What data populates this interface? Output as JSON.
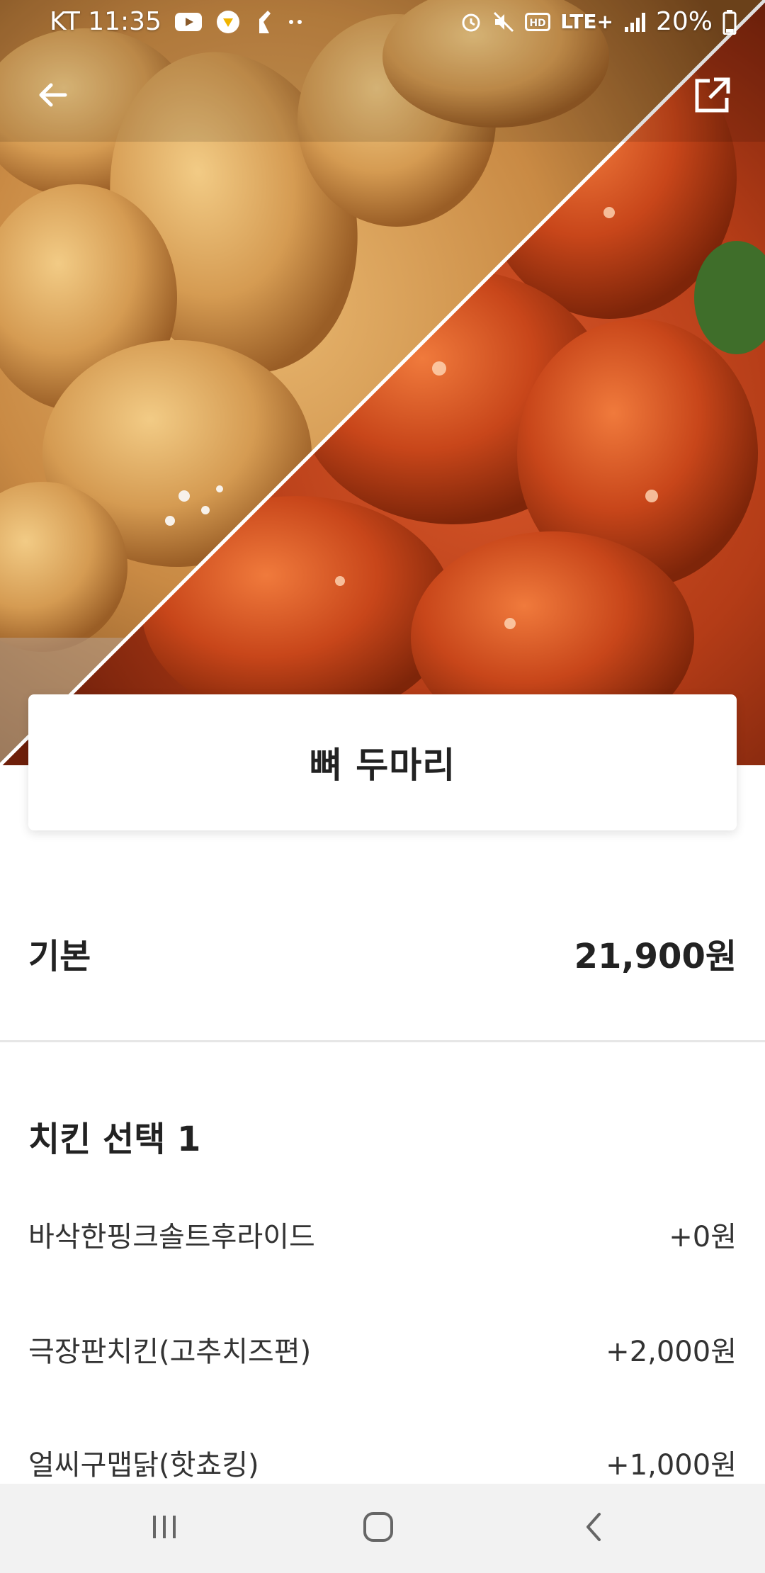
{
  "status_bar": {
    "carrier_time": "KT 11:35",
    "network": "LTE+",
    "battery": "20%",
    "icons_left": [
      "youtube-icon",
      "shield-icon",
      "app-icon",
      "more-dots-icon"
    ],
    "icons_right": [
      "alarm-icon",
      "mute-icon",
      "hd-icon",
      "lte-icon",
      "signal-icon",
      "battery-icon"
    ]
  },
  "header": {
    "back_icon": "arrow-left-icon",
    "share_icon": "share-external-icon"
  },
  "menu": {
    "title": "뼈 두마리"
  },
  "base_price": {
    "label": "기본",
    "value": "21,900원"
  },
  "options_section": {
    "title": "치킨 선택 1",
    "options": [
      {
        "name": "바삭한핑크솔트후라이드",
        "price": "+0원"
      },
      {
        "name": "극장판치킨(고추치즈편)",
        "price": "+2,000원"
      },
      {
        "name": "얼씨구맵닭(핫쵸킹)",
        "price": "+1,000원"
      }
    ]
  },
  "nav_bar": {
    "icons": [
      "recent-apps-icon",
      "home-icon",
      "back-icon"
    ]
  },
  "colors": {
    "text_primary": "#222222",
    "divider": "#e6e6e6",
    "nav_background": "#f2f2f2",
    "fried_chicken": "#d49a52",
    "sauced_chicken": "#b8401c"
  }
}
